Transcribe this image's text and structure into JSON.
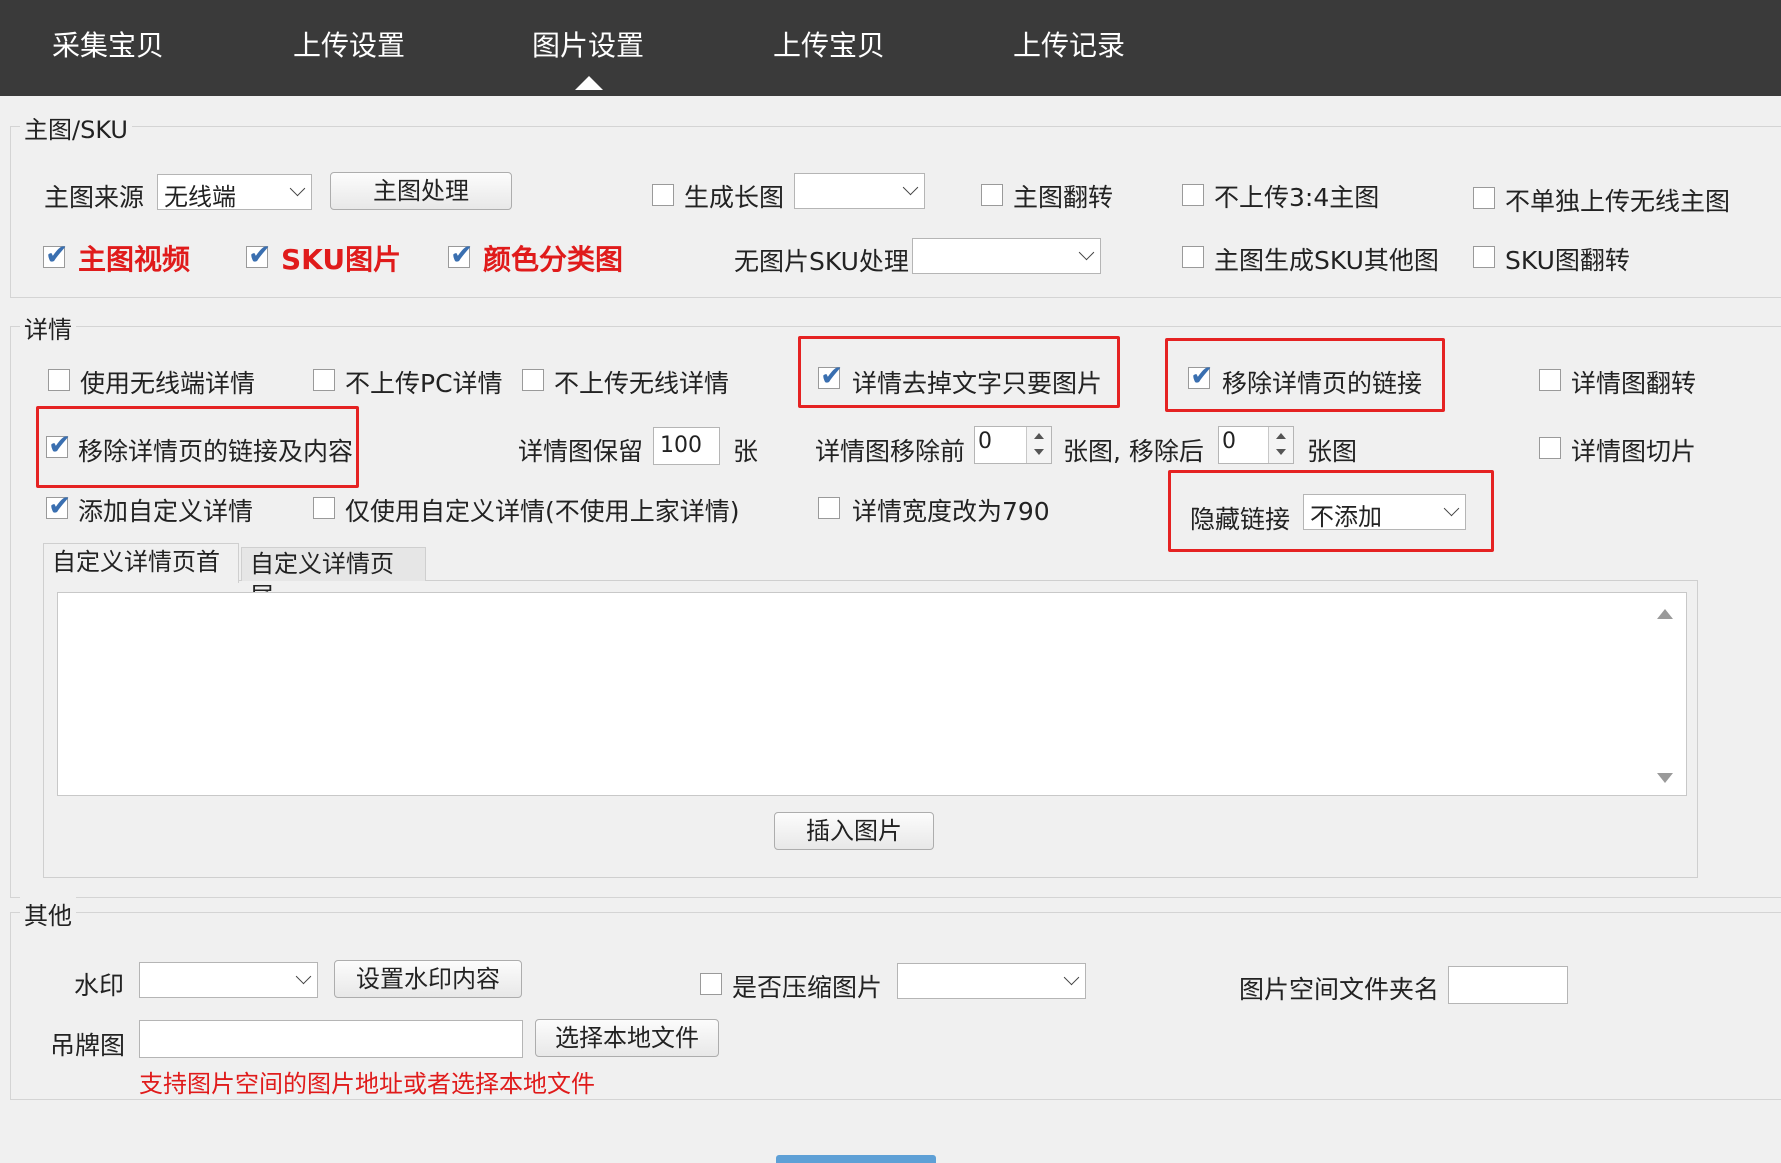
{
  "nav": {
    "tabs": [
      "采集宝贝",
      "上传设置",
      "图片设置",
      "上传宝贝",
      "上传记录"
    ],
    "active_tab": "图片设置"
  },
  "main_sku": {
    "legend": "主图/SKU",
    "main_source_label": "主图来源",
    "main_source_value": "无线端",
    "main_process_button": "主图处理",
    "gen_long_image": {
      "label": "生成长图",
      "checked": false,
      "select_value": ""
    },
    "main_flip": {
      "label": "主图翻转",
      "checked": false
    },
    "no_upload_34": {
      "label": "不上传3:4主图",
      "checked": false
    },
    "no_separate_wireless": {
      "label": "不单独上传无线主图",
      "checked": false
    },
    "main_video": {
      "label": "主图视频",
      "checked": true
    },
    "sku_image": {
      "label": "SKU图片",
      "checked": true
    },
    "color_category": {
      "label": "颜色分类图",
      "checked": true
    },
    "no_image_sku_label": "无图片SKU处理",
    "no_image_sku_value": "",
    "main_gen_sku_other": {
      "label": "主图生成SKU其他图",
      "checked": false
    },
    "sku_flip": {
      "label": "SKU图翻转",
      "checked": false
    }
  },
  "detail": {
    "legend": "详情",
    "use_wireless_detail": {
      "label": "使用无线端详情",
      "checked": false
    },
    "no_upload_pc": {
      "label": "不上传PC详情",
      "checked": false
    },
    "no_upload_wireless": {
      "label": "不上传无线详情",
      "checked": false
    },
    "remove_text_keep_images": {
      "label": "详情去掉文字只要图片",
      "checked": true
    },
    "remove_links": {
      "label": "移除详情页的链接",
      "checked": true
    },
    "detail_flip": {
      "label": "详情图翻转",
      "checked": false
    },
    "remove_links_and_content": {
      "label": "移除详情页的链接及内容",
      "checked": true
    },
    "keep_images_label": "详情图保留",
    "keep_images_value": "100",
    "keep_images_unit": "张",
    "remove_before_label": "详情图移除前",
    "remove_before_value": "0",
    "remove_after_label": "张图, 移除后",
    "remove_after_value": "0",
    "remove_after_unit": "张图",
    "detail_cut": {
      "label": "详情图切片",
      "checked": false
    },
    "add_custom": {
      "label": "添加自定义详情",
      "checked": true
    },
    "only_custom": {
      "label": "仅使用自定义详情(不使用上家详情)",
      "checked": false
    },
    "width_790": {
      "label": "详情宽度改为790",
      "checked": false
    },
    "hide_links_label": "隐藏链接",
    "hide_links_value": "不添加",
    "tabs": [
      "自定义详情页首",
      "自定义详情页尾"
    ],
    "insert_image_button": "插入图片"
  },
  "other": {
    "legend": "其他",
    "watermark_label": "水印",
    "watermark_value": "",
    "set_watermark_button": "设置水印内容",
    "compress": {
      "label": "是否压缩图片",
      "checked": false,
      "select_value": ""
    },
    "space_folder_label": "图片空间文件夹名",
    "space_folder_value": "",
    "hang_tag_label": "吊牌图",
    "hang_tag_value": "",
    "choose_local_button": "选择本地文件",
    "hint": "支持图片空间的图片地址或者选择本地文件"
  },
  "colors": {
    "nav_bg": "#3a3a3a",
    "highlight_red": "#e52222",
    "check_blue": "#3a6fb0",
    "hint_red": "#e01b1b"
  }
}
